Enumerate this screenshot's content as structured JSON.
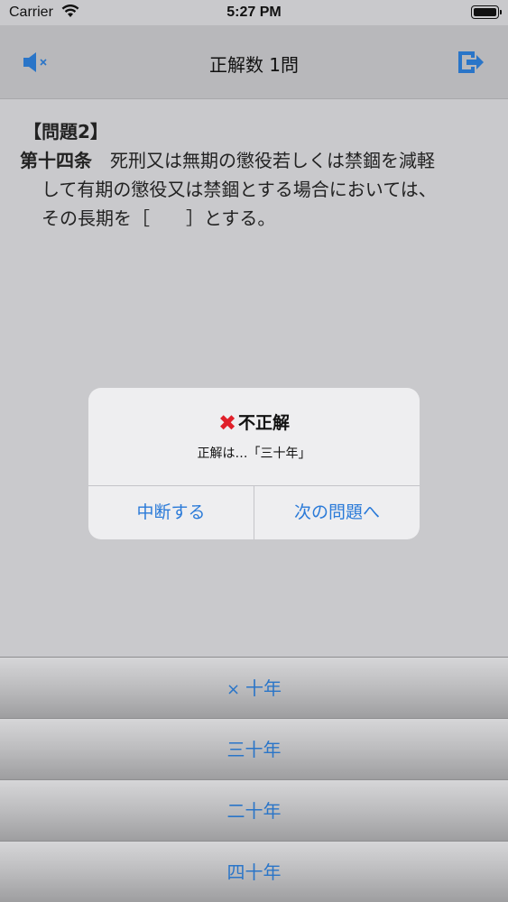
{
  "status_bar": {
    "carrier": "Carrier",
    "time": "5:27 PM"
  },
  "nav": {
    "title": "正解数 1問",
    "mute_icon": "speaker-muted-icon",
    "exit_icon": "exit-icon",
    "icon_color": "#2a75c8"
  },
  "question": {
    "number": "【問題2】",
    "article": "第十四条",
    "line1": "　死刑又は無期の懲役若しくは禁錮を減軽",
    "line2": "して有期の懲役又は禁錮とする場合においては、",
    "line3": "その長期を［　　］とする。"
  },
  "alert": {
    "mark": "❌",
    "title": "不正解",
    "message": "正解は…「三十年」",
    "button_left": "中断する",
    "button_right": "次の問題へ",
    "accent": "#2a7ad8"
  },
  "answers": [
    {
      "mark": "×",
      "label": "十年"
    },
    {
      "mark": "",
      "label": "三十年"
    },
    {
      "mark": "",
      "label": "二十年"
    },
    {
      "mark": "",
      "label": "四十年"
    }
  ]
}
